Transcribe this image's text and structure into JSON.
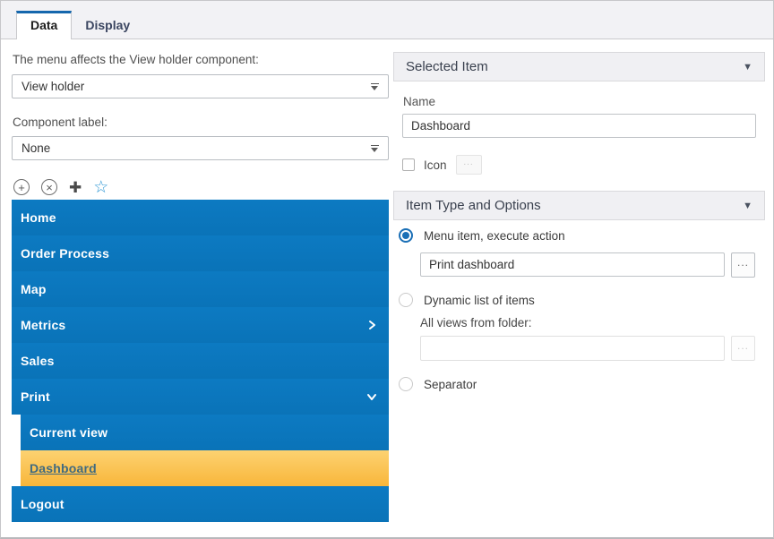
{
  "tabs": {
    "data_label": "Data",
    "display_label": "Display"
  },
  "left_panel": {
    "affect_label": "The menu affects the View holder component:",
    "component_dropdown_value": "View holder",
    "component_label_label": "Component label:",
    "label_dropdown_value": "None",
    "toolbar": {
      "circle_plus_glyph": "+",
      "circle_x_glyph": "×",
      "plus_glyph": "✚",
      "star_glyph": "☆"
    },
    "menu_items": [
      {
        "label": "Home"
      },
      {
        "label": "Order Process"
      },
      {
        "label": "Map"
      },
      {
        "label": "Metrics",
        "chevron": "right"
      },
      {
        "label": "Sales"
      },
      {
        "label": "Print",
        "chevron": "down"
      },
      {
        "label": "Current view",
        "indent": true
      },
      {
        "label": "Dashboard",
        "indent": true,
        "selected": true
      },
      {
        "label": "Logout"
      }
    ]
  },
  "right_panel": {
    "selected_item_header": "Selected Item",
    "collapse_caret_glyph": "▼",
    "name_label": "Name",
    "name_value": "Dashboard",
    "icon_label": "Icon",
    "browse_label": "...",
    "item_type_header": "Item Type and Options",
    "option_execute": {
      "label": "Menu item, execute action",
      "selected": true,
      "action_value": "Print dashboard"
    },
    "option_dynamic": {
      "label": "Dynamic list of items",
      "folder_label": "All views from folder:",
      "folder_value": ""
    },
    "option_separator": {
      "label": "Separator"
    }
  },
  "colors": {
    "accent_blue": "#1567ad",
    "menu_blue": "#0a75bb",
    "selection_yellow_top": "#fdd271",
    "selection_yellow_bottom": "#f8b63a",
    "selected_link_text": "#3f6a80",
    "header_bg": "#f0f0f3",
    "tabbar_bg": "#f2f2f5"
  }
}
